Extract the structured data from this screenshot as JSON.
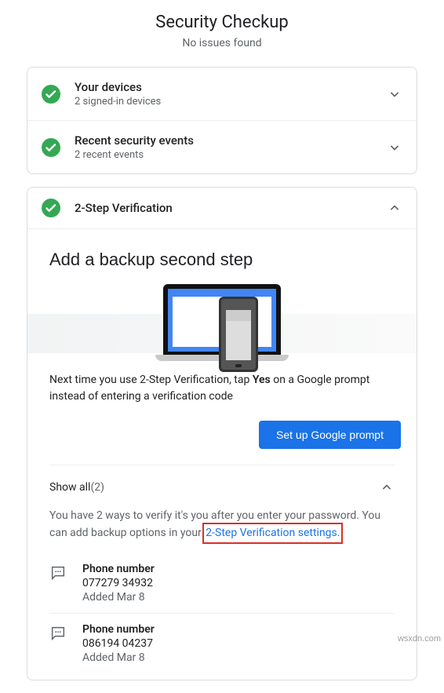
{
  "header": {
    "title": "Security Checkup",
    "subtitle": "No issues found"
  },
  "collapsed": [
    {
      "title": "Your devices",
      "subtitle": "2 signed-in devices"
    },
    {
      "title": "Recent security events",
      "subtitle": "2 recent events"
    }
  ],
  "expanded": {
    "title": "2-Step Verification",
    "backup": {
      "heading": "Add a backup second step",
      "tip_prefix": "Next time you use 2-Step Verification, tap ",
      "tip_bold": "Yes",
      "tip_suffix": " on a Google prompt instead of entering a verification code",
      "button": "Set up Google prompt"
    },
    "showall": {
      "label": "Show all ",
      "count": "(2)",
      "desc_prefix": "You have 2 ways to verify it's you after you enter your password. You can add backup options in your ",
      "link": "2-Step Verification settings.",
      "methods": [
        {
          "title": "Phone number",
          "value": "077279 34932",
          "added": "Added Mar 8"
        },
        {
          "title": "Phone number",
          "value": "086194 04237",
          "added": "Added Mar 8"
        }
      ]
    }
  },
  "watermark": "wsxdn.com"
}
